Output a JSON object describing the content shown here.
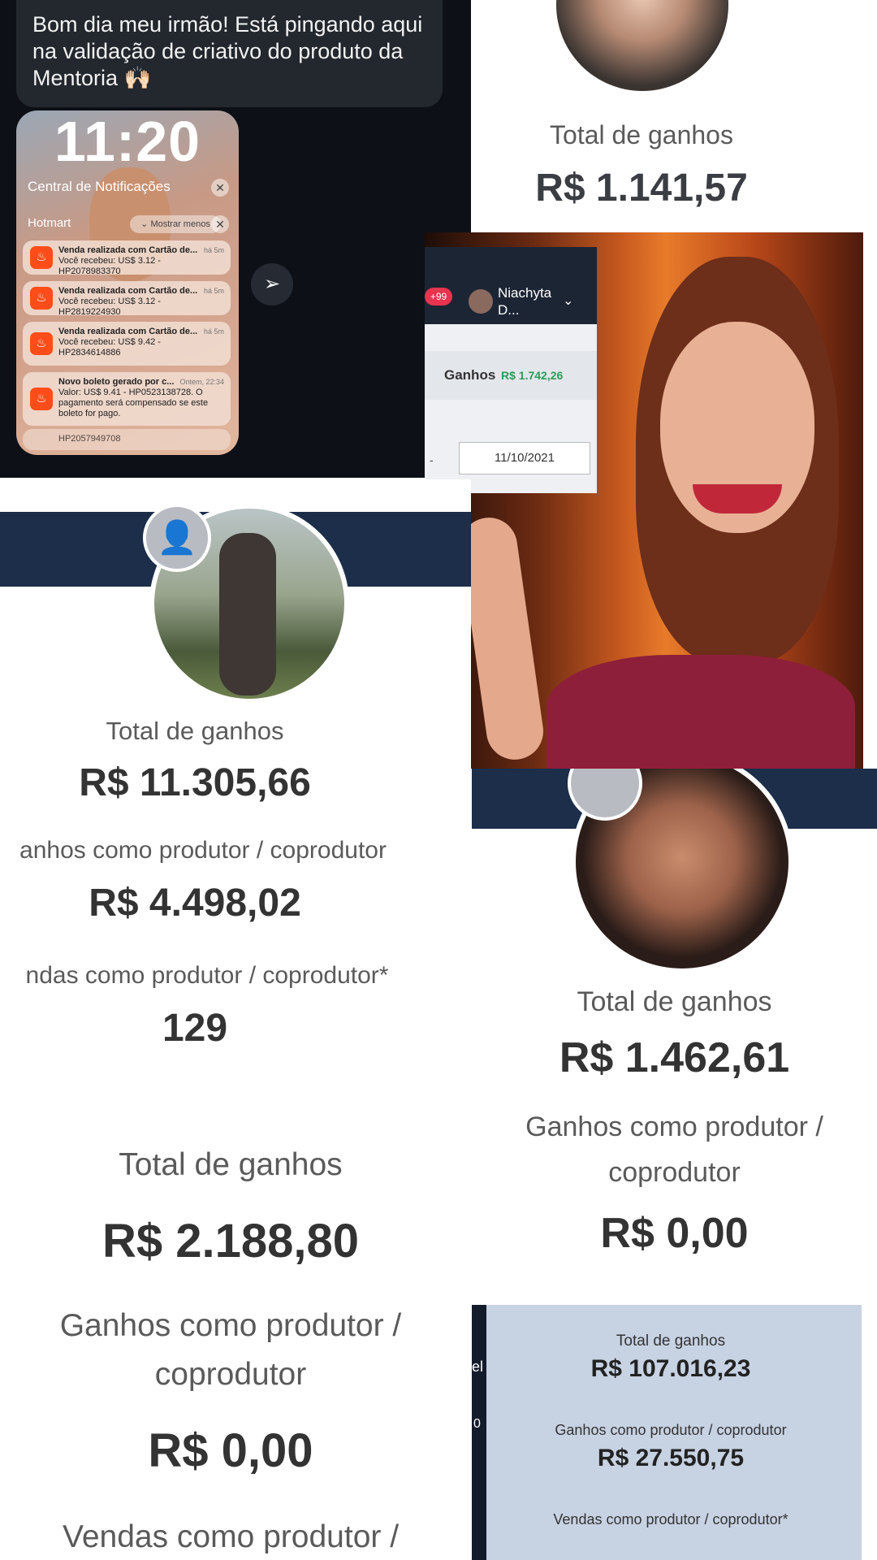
{
  "chat": {
    "message": "Bom dia meu irmão! Está pingando aqui na validação de criativo do produto da Mentoria 🙌🏻",
    "lock_time": "11:20",
    "notification_center": "Central de Notificações",
    "app_group": "Hotmart",
    "show_less": "Mostrar menos",
    "notifications": [
      {
        "title": "Venda realizada com Cartão de...",
        "ago": "há 5m",
        "body": "Você recebeu: US$ 3.12 - HP2078983370"
      },
      {
        "title": "Venda realizada com Cartão de...",
        "ago": "há 5m",
        "body": "Você recebeu: US$ 3.12 - HP2819224930"
      },
      {
        "title": "Venda realizada com Cartão de...",
        "ago": "há 5m",
        "body": "Você recebeu: US$ 9.42 - HP2834614886"
      },
      {
        "title": "Novo boleto gerado por c...",
        "ago": "Ontem, 22:34",
        "body": "Valor: US$ 9.41 - HP0523138728. O pagamento será compensado se este boleto for pago."
      }
    ],
    "stacked_bottom": "HP2057949708"
  },
  "panel_b": {
    "label": "Total de ganhos",
    "value": "R$ 1.141,57"
  },
  "panel_c": {
    "badge": "+99",
    "user": "Niachyta D...",
    "earnings_label": "Ganhos",
    "earnings_value": "R$ 1.742,26",
    "date_dash": "-",
    "date": "11/10/2021"
  },
  "panel_d": {
    "total_label": "Total de ganhos",
    "total_value": "R$ 11.305,66",
    "prod_label": "anhos como produtor / coprodutor",
    "prod_value": "R$ 4.498,02",
    "sales_label": "ndas como produtor / coprodutor*",
    "sales_value": "129"
  },
  "panel_e": {
    "total_label": "Total de ganhos",
    "total_value": "R$ 1.462,61",
    "prod_label_1": "Ganhos como produtor /",
    "prod_label_2": "coprodutor",
    "prod_value": "R$ 0,00"
  },
  "panel_f": {
    "total_label": "Total de ganhos",
    "total_value": "R$ 2.188,80",
    "prod_label_1": "Ganhos como produtor /",
    "prod_label_2": "coprodutor",
    "prod_value": "R$ 0,00",
    "sales_label": "Vendas como produtor /"
  },
  "panel_g": {
    "total_label": "Total de ganhos",
    "total_value": "R$ 107.016,23",
    "prod_label": "Ganhos como produtor / coprodutor",
    "prod_value": "R$ 27.550,75",
    "sales_label": "Vendas como produtor / coprodutor*",
    "side_1": "el",
    "side_2": "0"
  },
  "colors": {
    "hotmart": "#ff4d1a",
    "dashboard_navy": "#1c2e4a",
    "earnings_green": "#2e9b57",
    "badge_red": "#e8344e"
  }
}
